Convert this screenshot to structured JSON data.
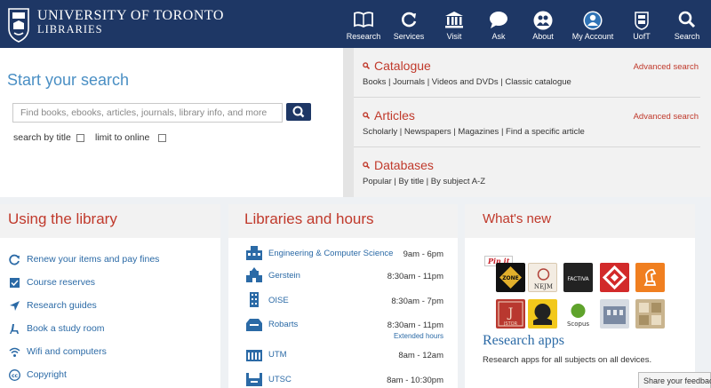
{
  "header": {
    "logo_line1": "UNIVERSITY OF TORONTO",
    "logo_line2": "LIBRARIES",
    "nav": [
      {
        "label": "Research",
        "icon": "book-icon"
      },
      {
        "label": "Services",
        "icon": "refresh-icon"
      },
      {
        "label": "Visit",
        "icon": "building-icon"
      },
      {
        "label": "Ask",
        "icon": "chat-icon"
      },
      {
        "label": "About",
        "icon": "people-icon"
      },
      {
        "label": "My Account",
        "icon": "user-icon"
      },
      {
        "label": "UofT",
        "icon": "crest-icon"
      },
      {
        "label": "Search",
        "icon": "search-icon"
      }
    ]
  },
  "search": {
    "title": "Start your search",
    "placeholder": "Find books, ebooks, articles, journals, library info, and more",
    "opt_title": "search by title",
    "opt_online": "limit to online"
  },
  "resources": [
    {
      "title": "Catalogue",
      "advanced": "Advanced search",
      "links": "Books | Journals | Videos and DVDs | Classic catalogue"
    },
    {
      "title": "Articles",
      "advanced": "Advanced search",
      "links": "Scholarly | Newspapers | Magazines | Find a specific article"
    },
    {
      "title": "Databases",
      "advanced": "",
      "links": "Popular | By title | By subject A-Z"
    }
  ],
  "using": {
    "title": "Using the library",
    "items": [
      {
        "label": "Renew your items and pay fines",
        "icon": "renew-icon"
      },
      {
        "label": "Course reserves",
        "icon": "reserves-icon"
      },
      {
        "label": "Research guides",
        "icon": "arrow-icon"
      },
      {
        "label": "Book a study room",
        "icon": "chair-icon"
      },
      {
        "label": "Wifi and computers",
        "icon": "wifi-icon"
      },
      {
        "label": "Copyright",
        "icon": "copyright-icon"
      }
    ]
  },
  "hours": {
    "title": "Libraries and hours",
    "rows": [
      {
        "name": "Engineering & Computer Science",
        "time": "9am - 6pm",
        "extra": ""
      },
      {
        "name": "Gerstein",
        "time": "8:30am - 11pm",
        "extra": ""
      },
      {
        "name": "OISE",
        "time": "8:30am - 7pm",
        "extra": ""
      },
      {
        "name": "Robarts",
        "time": "8:30am - 11pm",
        "extra": "Extended hours"
      },
      {
        "name": "UTM",
        "time": "8am - 12am",
        "extra": ""
      },
      {
        "name": "UTSC",
        "time": "8am - 10:30pm",
        "extra": ""
      }
    ]
  },
  "whatsnew": {
    "title": "What's new",
    "pinit": "Pin it",
    "apps_title": "Research apps",
    "apps_desc": "Research apps for all subjects on all devices.",
    "app_labels": {
      "nejm": "NEJM",
      "factiva": "FACTIVA",
      "jstor": "JSTOR",
      "scopus": "Scopus"
    }
  },
  "feedback": "Share your feedback",
  "colors": {
    "navy": "#1e3765",
    "accent_red": "#c0392b",
    "link_blue": "#2b6aa6"
  }
}
